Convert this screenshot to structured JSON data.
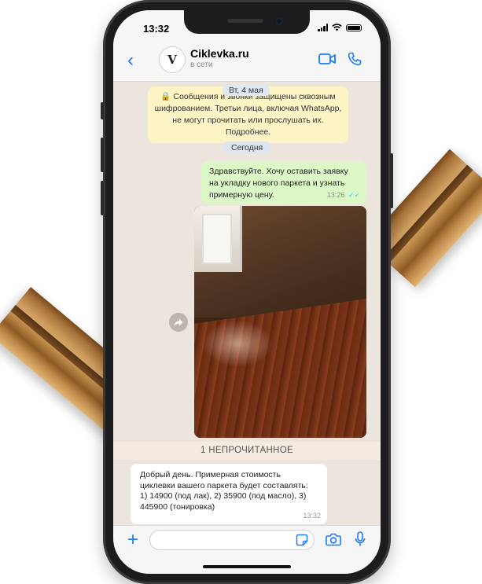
{
  "status_bar": {
    "time": "13:32"
  },
  "header": {
    "back_glyph": "‹",
    "avatar_letter": "V",
    "contact_name": "Ciklevka.ru",
    "contact_status": "в сети",
    "icons": [
      "video-call-icon",
      "phone-call-icon"
    ]
  },
  "chat": {
    "date_pill": "Вт, 4 мая",
    "encryption_notice": "Сообщения и звонки защищены сквозным шифрованием. Третьи лица, включая WhatsApp, не могут прочитать или прослушать их. Подробнее.",
    "today_pill": "Сегодня",
    "outgoing": {
      "text": "Здравствуйте. Хочу оставить заявку на укладку нового паркета и узнать примерную цену.",
      "time": "13:26",
      "ticks": "✓✓"
    },
    "unread_bar": "1 НЕПРОЧИТАННОЕ",
    "incoming": {
      "text": "Добрый день. Примерная стоимость циклевки вашего паркета будет составлять: 1) 14900 (под лак), 2) 35900 (под масло), 3) 445900 (тонировка)",
      "time": "13:32"
    }
  },
  "input_bar": {
    "plus_glyph": "+",
    "placeholder": ""
  },
  "colors": {
    "accent": "#1b7cf5",
    "outgoing_bubble": "#dcf8c6",
    "chat_background": "#ece5dd",
    "encryption_notice": "#fdf4c5",
    "read_ticks": "#4fb6ec"
  }
}
